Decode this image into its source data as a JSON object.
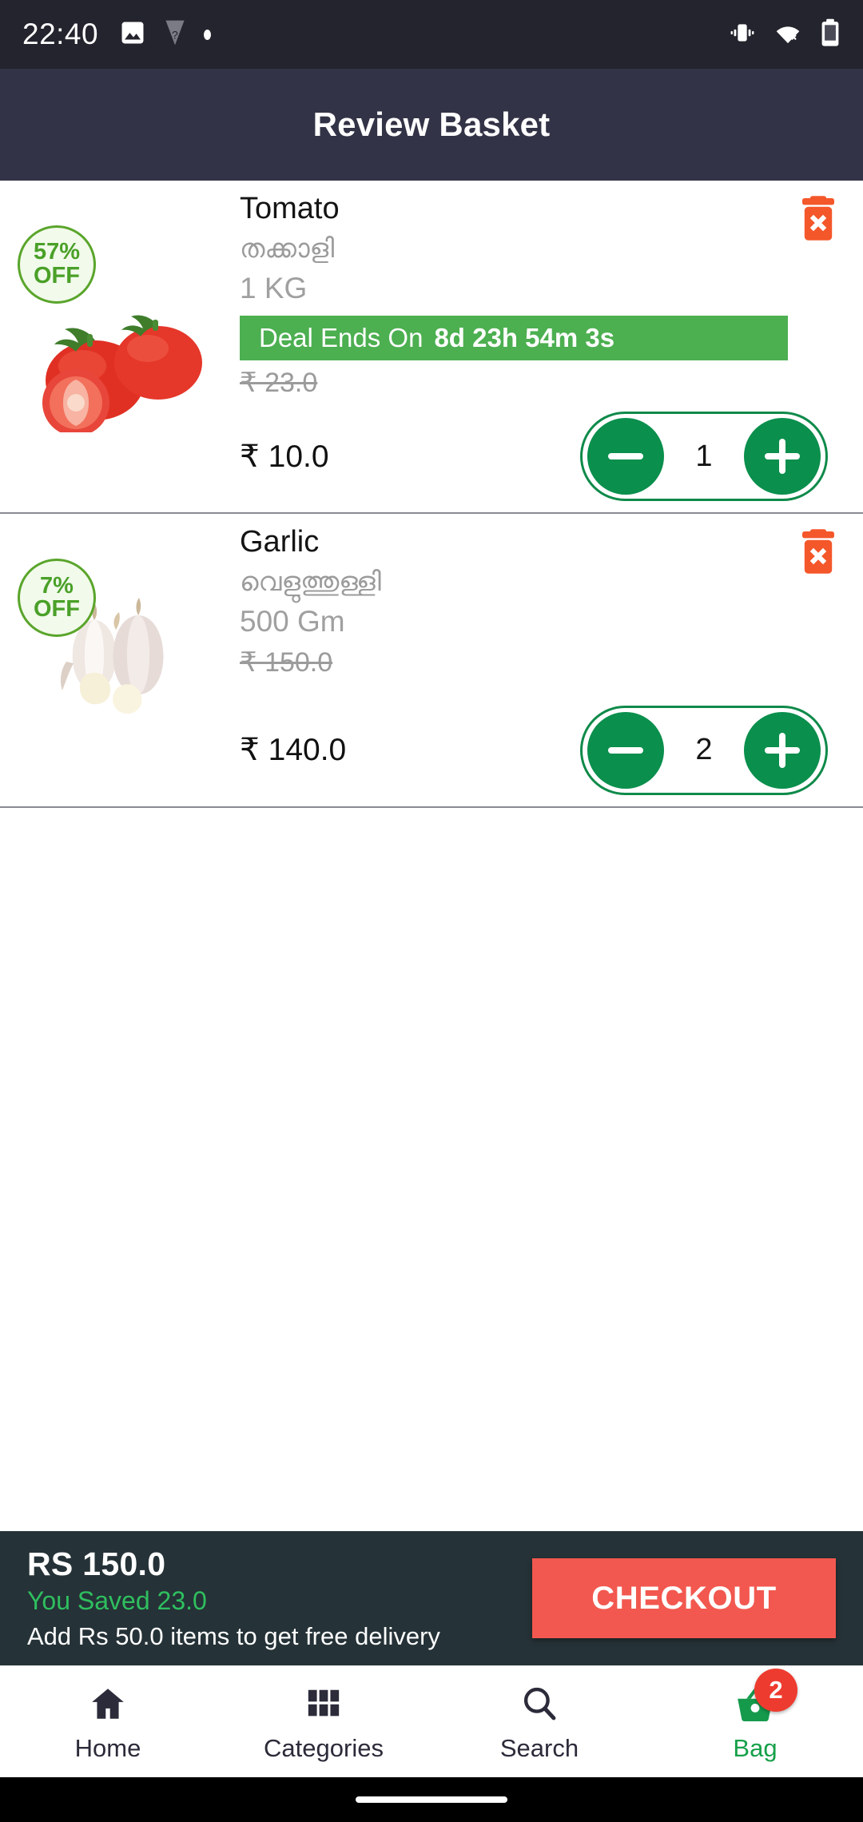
{
  "status_bar": {
    "time": "22:40",
    "left_icons": [
      "image-icon",
      "unknown-app-icon",
      "dot-indicator"
    ],
    "right_icons": [
      "vibrate-icon",
      "wifi-off-icon",
      "battery-icon"
    ]
  },
  "app_bar": {
    "title": "Review Basket",
    "background": "#333347"
  },
  "items": [
    {
      "name": "Tomato",
      "local_name": "തക്കാളി",
      "quantity_label": "1 KG",
      "discount_badge": {
        "percent": "57%",
        "off": "OFF"
      },
      "deal": {
        "label": "Deal Ends On",
        "time": "8d 23h 54m 3s",
        "color": "#4caf50"
      },
      "old_price": "₹ 23.0",
      "price": "₹ 10.0",
      "count": "1",
      "image": "tomato-image",
      "delete_icon": "trash-delete-icon"
    },
    {
      "name": "Garlic",
      "local_name": "വെളുത്തുള്ളി",
      "quantity_label": "500 Gm",
      "discount_badge": {
        "percent": "7%",
        "off": "OFF"
      },
      "deal": null,
      "old_price": "₹ 150.0",
      "price": "₹ 140.0",
      "count": "2",
      "image": "garlic-image",
      "delete_icon": "trash-delete-icon"
    }
  ],
  "checkout_bar": {
    "total": "RS 150.0",
    "saved": "You Saved 23.0",
    "free_delivery_note": "Add Rs 50.0 items to get free delivery",
    "button_label": "CHECKOUT",
    "button_color": "#f2584f",
    "background": "#253237",
    "saved_color": "#2fbf5f"
  },
  "bottom_nav": {
    "items": [
      {
        "label": "Home",
        "icon": "home-icon",
        "active": false,
        "badge": null
      },
      {
        "label": "Categories",
        "icon": "grid-icon",
        "active": false,
        "badge": null
      },
      {
        "label": "Search",
        "icon": "search-icon",
        "active": false,
        "badge": null
      },
      {
        "label": "Bag",
        "icon": "basket-icon",
        "active": true,
        "badge": "2"
      }
    ],
    "active_color": "#17a04a",
    "badge_color": "#ee3b2f"
  }
}
